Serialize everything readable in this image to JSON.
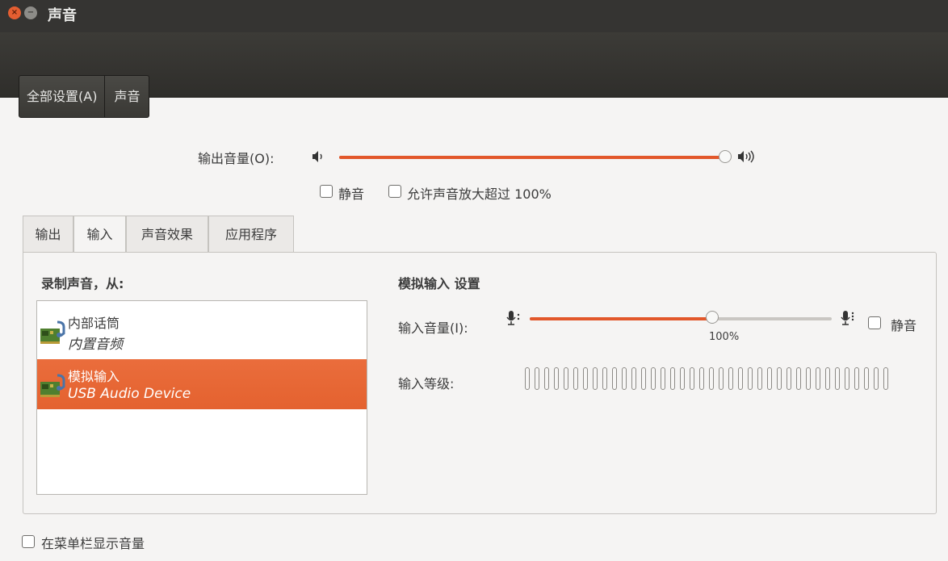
{
  "window": {
    "title": "声音",
    "close_glyph": "×",
    "minimize_glyph": "−"
  },
  "nav": {
    "all_settings": "全部设置(A)",
    "current": "声音"
  },
  "output": {
    "label": "输出音量(O):",
    "volume_fraction": 0.99,
    "mute_label": "静音",
    "overamplify_label": "允许声音放大超过 100%",
    "mute_checked": false,
    "overamplify_checked": false
  },
  "tabs": [
    {
      "label": "输出",
      "active": false
    },
    {
      "label": "输入",
      "active": true
    },
    {
      "label": "声音效果",
      "active": false
    },
    {
      "label": "应用程序",
      "active": false
    }
  ],
  "input": {
    "record_from_label": "录制声音，从:",
    "devices": [
      {
        "name": "内部话筒",
        "description": "内置音频",
        "selected": false
      },
      {
        "name": "模拟输入",
        "description": "USB Audio Device",
        "selected": true
      }
    ],
    "settings_heading": "模拟输入 设置",
    "volume_label": "输入音量(I):",
    "volume_percent": 100,
    "volume_mark_label": "100%",
    "mute_label": "静音",
    "mute_checked": false,
    "level_label": "输入等级:",
    "level_segments": 38,
    "level_active_segments": 0
  },
  "footer": {
    "show_in_menubar_label": "在菜单栏显示音量",
    "checked": false
  },
  "colors": {
    "accent": "#e2572a",
    "selection": "#e8683a",
    "titlebar": "#353432"
  },
  "icons": [
    "close-icon",
    "minimize-icon",
    "speaker-low-icon",
    "speaker-high-icon",
    "microphone-low-icon",
    "microphone-high-icon",
    "sound-card-icon"
  ]
}
